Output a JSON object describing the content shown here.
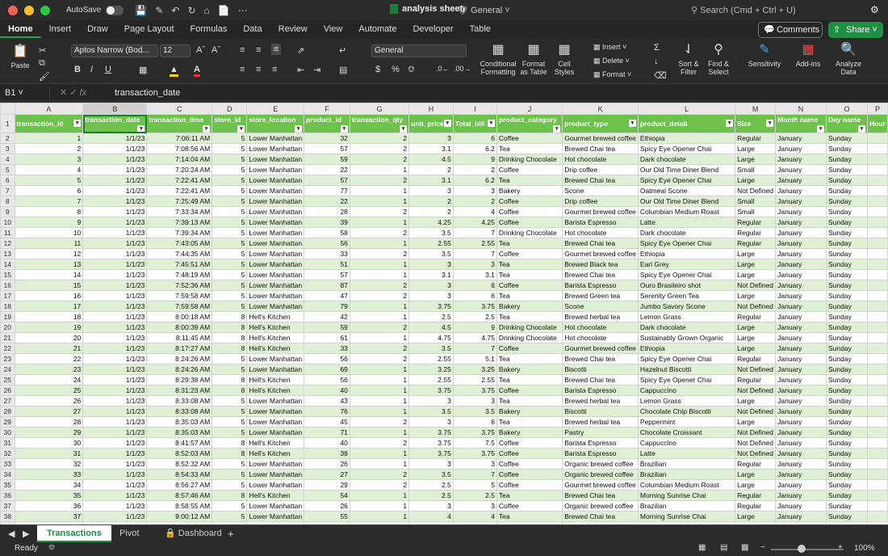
{
  "window": {
    "autosave_label": "AutoSave",
    "doc_title": "analysis sheet",
    "sensitivity_label": "General",
    "search_placeholder": "Search (Cmd + Ctrl + U)"
  },
  "ribbon_tabs": [
    "Home",
    "Insert",
    "Draw",
    "Page Layout",
    "Formulas",
    "Data",
    "Review",
    "View",
    "Automate",
    "Developer",
    "Table"
  ],
  "ribbon": {
    "comments": "Comments",
    "share": "Share",
    "paste": "Paste",
    "font_name": "Aptos Narrow (Bod...",
    "font_size": "12",
    "number_format": "General",
    "conditional_formatting": "Conditional Formatting",
    "format_as_table": "Format as Table",
    "cell_styles": "Cell Styles",
    "insert": "Insert",
    "delete": "Delete",
    "format": "Format",
    "sort_filter": "Sort & Filter",
    "find_select": "Find & Select",
    "sensitivity": "Sensitivity",
    "addins": "Add-ins",
    "analyze_data": "Analyze Data"
  },
  "formula_bar": {
    "name_box": "B1",
    "formula": "transaction_date"
  },
  "columns": [
    "A",
    "B",
    "C",
    "D",
    "E",
    "F",
    "G",
    "H",
    "I",
    "J",
    "K",
    "L",
    "M",
    "N",
    "O",
    "P"
  ],
  "headers": [
    "transaction_id",
    "transaction_date",
    "transaction_time",
    "store_id",
    "store_location",
    "product_id",
    "transaction_qty",
    "unit_price",
    "Total_bill",
    "product_category",
    "product_type",
    "product_detail",
    "Size",
    "Month name",
    "Day name",
    "Hour"
  ],
  "rows": [
    [
      "1",
      "1/1/23",
      "7:06:11 AM",
      "5",
      "Lower Manhattan",
      "32",
      "2",
      "3",
      "6",
      "Coffee",
      "Gourmet brewed coffee",
      "Ethiopia",
      "Regular",
      "January",
      "Sunday"
    ],
    [
      "2",
      "1/1/23",
      "7:08:56 AM",
      "5",
      "Lower Manhattan",
      "57",
      "2",
      "3.1",
      "6.2",
      "Tea",
      "Brewed Chai tea",
      "Spicy Eye Opener Chai",
      "Large",
      "January",
      "Sunday"
    ],
    [
      "3",
      "1/1/23",
      "7:14:04 AM",
      "5",
      "Lower Manhattan",
      "59",
      "2",
      "4.5",
      "9",
      "Drinking Chocolate",
      "Hot chocolate",
      "Dark chocolate",
      "Large",
      "January",
      "Sunday"
    ],
    [
      "4",
      "1/1/23",
      "7:20:24 AM",
      "5",
      "Lower Manhattan",
      "22",
      "1",
      "2",
      "2",
      "Coffee",
      "Drip coffee",
      "Our Old Time Diner Blend",
      "Small",
      "January",
      "Sunday"
    ],
    [
      "5",
      "1/1/23",
      "7:22:41 AM",
      "5",
      "Lower Manhattan",
      "57",
      "2",
      "3.1",
      "6.2",
      "Tea",
      "Brewed Chai tea",
      "Spicy Eye Opener Chai",
      "Large",
      "January",
      "Sunday"
    ],
    [
      "6",
      "1/1/23",
      "7:22:41 AM",
      "5",
      "Lower Manhattan",
      "77",
      "1",
      "3",
      "3",
      "Bakery",
      "Scone",
      "Oatmeal Scone",
      "Not Defined",
      "January",
      "Sunday"
    ],
    [
      "7",
      "1/1/23",
      "7:25:49 AM",
      "5",
      "Lower Manhattan",
      "22",
      "1",
      "2",
      "2",
      "Coffee",
      "Drip coffee",
      "Our Old Time Diner Blend",
      "Small",
      "January",
      "Sunday"
    ],
    [
      "8",
      "1/1/23",
      "7:33:34 AM",
      "5",
      "Lower Manhattan",
      "28",
      "2",
      "2",
      "4",
      "Coffee",
      "Gourmet brewed coffee",
      "Columbian Medium Roast",
      "Small",
      "January",
      "Sunday"
    ],
    [
      "9",
      "1/1/23",
      "7:39:13 AM",
      "5",
      "Lower Manhattan",
      "39",
      "1",
      "4.25",
      "4.25",
      "Coffee",
      "Barista Espresso",
      "Latte",
      "Regular",
      "January",
      "Sunday"
    ],
    [
      "10",
      "1/1/23",
      "7:39:34 AM",
      "5",
      "Lower Manhattan",
      "58",
      "2",
      "3.5",
      "7",
      "Drinking Chocolate",
      "Hot chocolate",
      "Dark chocolate",
      "Regular",
      "January",
      "Sunday"
    ],
    [
      "11",
      "1/1/23",
      "7:43:05 AM",
      "5",
      "Lower Manhattan",
      "56",
      "1",
      "2.55",
      "2.55",
      "Tea",
      "Brewed Chai tea",
      "Spicy Eye Opener Chai",
      "Regular",
      "January",
      "Sunday"
    ],
    [
      "12",
      "1/1/23",
      "7:44:35 AM",
      "5",
      "Lower Manhattan",
      "33",
      "2",
      "3.5",
      "7",
      "Coffee",
      "Gourmet brewed coffee",
      "Ethiopia",
      "Large",
      "January",
      "Sunday"
    ],
    [
      "13",
      "1/1/23",
      "7:45:51 AM",
      "5",
      "Lower Manhattan",
      "51",
      "1",
      "3",
      "3",
      "Tea",
      "Brewed Black tea",
      "Earl Grey",
      "Large",
      "January",
      "Sunday"
    ],
    [
      "14",
      "1/1/23",
      "7:48:19 AM",
      "5",
      "Lower Manhattan",
      "57",
      "1",
      "3.1",
      "3.1",
      "Tea",
      "Brewed Chai tea",
      "Spicy Eye Opener Chai",
      "Large",
      "January",
      "Sunday"
    ],
    [
      "15",
      "1/1/23",
      "7:52:36 AM",
      "5",
      "Lower Manhattan",
      "87",
      "2",
      "3",
      "6",
      "Coffee",
      "Barista Espresso",
      "Ouro Brasileiro shot",
      "Not Defined",
      "January",
      "Sunday"
    ],
    [
      "16",
      "1/1/23",
      "7:59:58 AM",
      "5",
      "Lower Manhattan",
      "47",
      "2",
      "3",
      "6",
      "Tea",
      "Brewed Green tea",
      "Serenity Green Tea",
      "Large",
      "January",
      "Sunday"
    ],
    [
      "17",
      "1/1/23",
      "7:59:58 AM",
      "5",
      "Lower Manhattan",
      "79",
      "1",
      "3.75",
      "3.75",
      "Bakery",
      "Scone",
      "Jumbo Savory Scone",
      "Not Defined",
      "January",
      "Sunday"
    ],
    [
      "18",
      "1/1/23",
      "8:00:18 AM",
      "8",
      "Hell's Kitchen",
      "42",
      "1",
      "2.5",
      "2.5",
      "Tea",
      "Brewed herbal tea",
      "Lemon Grass",
      "Regular",
      "January",
      "Sunday"
    ],
    [
      "19",
      "1/1/23",
      "8:00:39 AM",
      "8",
      "Hell's Kitchen",
      "59",
      "2",
      "4.5",
      "9",
      "Drinking Chocolate",
      "Hot chocolate",
      "Dark chocolate",
      "Large",
      "January",
      "Sunday"
    ],
    [
      "20",
      "1/1/23",
      "8:11:45 AM",
      "8",
      "Hell's Kitchen",
      "61",
      "1",
      "4.75",
      "4.75",
      "Drinking Chocolate",
      "Hot chocolate",
      "Sustainably Grown Organic",
      "Large",
      "January",
      "Sunday"
    ],
    [
      "21",
      "1/1/23",
      "8:17:27 AM",
      "8",
      "Hell's Kitchen",
      "33",
      "2",
      "3.5",
      "7",
      "Coffee",
      "Gourmet brewed coffee",
      "Ethiopia",
      "Large",
      "January",
      "Sunday"
    ],
    [
      "22",
      "1/1/23",
      "8:24:26 AM",
      "5",
      "Lower Manhattan",
      "56",
      "2",
      "2.55",
      "5.1",
      "Tea",
      "Brewed Chai tea",
      "Spicy Eye Opener Chai",
      "Regular",
      "January",
      "Sunday"
    ],
    [
      "23",
      "1/1/23",
      "8:24:26 AM",
      "5",
      "Lower Manhattan",
      "69",
      "1",
      "3.25",
      "3.25",
      "Bakery",
      "Biscotti",
      "Hazelnut Biscotti",
      "Not Defined",
      "January",
      "Sunday"
    ],
    [
      "24",
      "1/1/23",
      "8:29:38 AM",
      "8",
      "Hell's Kitchen",
      "56",
      "1",
      "2.55",
      "2.55",
      "Tea",
      "Brewed Chai tea",
      "Spicy Eye Opener Chai",
      "Regular",
      "January",
      "Sunday"
    ],
    [
      "25",
      "1/1/23",
      "8:31:23 AM",
      "8",
      "Hell's Kitchen",
      "40",
      "1",
      "3.75",
      "3.75",
      "Coffee",
      "Barista Espresso",
      "Cappuccino",
      "Not Defined",
      "January",
      "Sunday"
    ],
    [
      "26",
      "1/1/23",
      "8:33:08 AM",
      "5",
      "Lower Manhattan",
      "43",
      "1",
      "3",
      "3",
      "Tea",
      "Brewed herbal tea",
      "Lemon Grass",
      "Large",
      "January",
      "Sunday"
    ],
    [
      "27",
      "1/1/23",
      "8:33:08 AM",
      "5",
      "Lower Manhattan",
      "76",
      "1",
      "3.5",
      "3.5",
      "Bakery",
      "Biscotti",
      "Chocolate Chip Biscotti",
      "Not Defined",
      "January",
      "Sunday"
    ],
    [
      "28",
      "1/1/23",
      "8:35:03 AM",
      "5",
      "Lower Manhattan",
      "45",
      "2",
      "3",
      "6",
      "Tea",
      "Brewed herbal tea",
      "Peppermint",
      "Large",
      "January",
      "Sunday"
    ],
    [
      "29",
      "1/1/23",
      "8:35:03 AM",
      "5",
      "Lower Manhattan",
      "71",
      "1",
      "3.75",
      "3.75",
      "Bakery",
      "Pastry",
      "Chocolate Croissant",
      "Not Defined",
      "January",
      "Sunday"
    ],
    [
      "30",
      "1/1/23",
      "8:41:57 AM",
      "8",
      "Hell's Kitchen",
      "40",
      "2",
      "3.75",
      "7.5",
      "Coffee",
      "Barista Espresso",
      "Cappuccino",
      "Not Defined",
      "January",
      "Sunday"
    ],
    [
      "31",
      "1/1/23",
      "8:52:03 AM",
      "8",
      "Hell's Kitchen",
      "38",
      "1",
      "3.75",
      "3.75",
      "Coffee",
      "Barista Espresso",
      "Latte",
      "Not Defined",
      "January",
      "Sunday"
    ],
    [
      "32",
      "1/1/23",
      "8:52:32 AM",
      "5",
      "Lower Manhattan",
      "26",
      "1",
      "3",
      "3",
      "Coffee",
      "Organic brewed coffee",
      "Brazilian",
      "Regular",
      "January",
      "Sunday"
    ],
    [
      "33",
      "1/1/23",
      "8:54:33 AM",
      "5",
      "Lower Manhattan",
      "27",
      "2",
      "3.5",
      "7",
      "Coffee",
      "Organic brewed coffee",
      "Brazilian",
      "Large",
      "January",
      "Sunday"
    ],
    [
      "34",
      "1/1/23",
      "8:56:27 AM",
      "5",
      "Lower Manhattan",
      "29",
      "2",
      "2.5",
      "5",
      "Coffee",
      "Gourmet brewed coffee",
      "Columbian Medium Roast",
      "Large",
      "January",
      "Sunday"
    ],
    [
      "35",
      "1/1/23",
      "8:57:46 AM",
      "8",
      "Hell's Kitchen",
      "54",
      "1",
      "2.5",
      "2.5",
      "Tea",
      "Brewed Chai tea",
      "Morning Sunrise Chai",
      "Regular",
      "January",
      "Sunday"
    ],
    [
      "36",
      "1/1/23",
      "8:58:55 AM",
      "5",
      "Lower Manhattan",
      "26",
      "1",
      "3",
      "3",
      "Coffee",
      "Organic brewed coffee",
      "Brazilian",
      "Regular",
      "January",
      "Sunday"
    ],
    [
      "37",
      "1/1/23",
      "9:00:12 AM",
      "5",
      "Lower Manhattan",
      "55",
      "1",
      "4",
      "4",
      "Tea",
      "Brewed Chai tea",
      "Morning Sunrise Chai",
      "Large",
      "January",
      "Sunday"
    ],
    [
      "38",
      "1/1/23",
      "9:00:24 AM",
      "8",
      "Hell's Kitchen",
      "40",
      "2",
      "3.75",
      "7.5",
      "Coffee",
      "Barista Espresso",
      "Cappuccino",
      "Not Defined",
      "January",
      "Sunday"
    ],
    [
      "39",
      "1/1/23",
      "9:07:13 AM",
      "8",
      "Hell's Kitchen",
      "45",
      "1",
      "3",
      "3",
      "Tea",
      "Brewed herbal tea",
      "Peppermint",
      "Large",
      "January",
      "Sunday"
    ],
    [
      "40",
      "1/1/23",
      "9:08:09 AM",
      "8",
      "Hell's Kitchen",
      "45",
      "2",
      "3",
      "6",
      "Tea",
      "Brewed herbal tea",
      "Peppermint",
      "Large",
      "January",
      "Sunday"
    ]
  ],
  "sheets": [
    "Transactions",
    "Pivot",
    "Dashboard"
  ],
  "status": {
    "ready": "Ready",
    "zoom": "100%"
  },
  "colors": {
    "header_green": "#6cc24a",
    "band_green": "#dff0d4",
    "accent": "#1f8f45"
  }
}
